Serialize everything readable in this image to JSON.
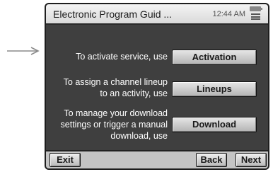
{
  "header": {
    "title": "Electronic Program Guid ...",
    "time": "12:44 AM",
    "icons": [
      "battery-icon",
      "menu-icon"
    ]
  },
  "rows": [
    {
      "label_lines": [
        "To activate service, use"
      ],
      "button": "Activation"
    },
    {
      "label_lines": [
        "To assign a channel lineup",
        "to an activity, use"
      ],
      "button": "Lineups"
    },
    {
      "label_lines": [
        "To manage your download",
        "settings or trigger a manual",
        "download, use"
      ],
      "button": "Download"
    }
  ],
  "footer": {
    "exit": "Exit",
    "back": "Back",
    "next": "Next"
  },
  "pointer": {
    "icon": "pointer-arrow-icon"
  },
  "colors": {
    "screen_background": "#3f3f3f",
    "title_bar": "#e6e6e6",
    "bottom_bar": "#c4c4c4",
    "button": "#cccccc"
  }
}
